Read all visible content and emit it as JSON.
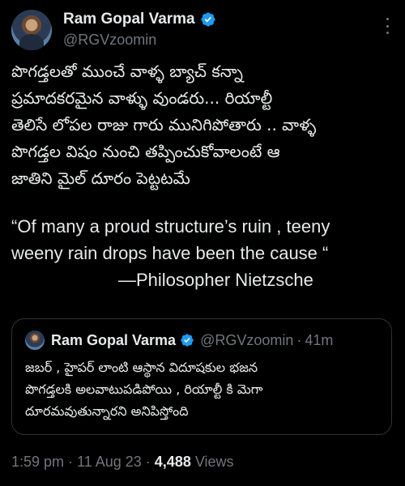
{
  "author": {
    "display_name": "Ram Gopal Varma",
    "handle": "@RGVzoomin",
    "verified_icon": "verified-badge-icon",
    "badge_color": "#1d9bf0"
  },
  "tweet": {
    "telugu_lines": [
      "పొగడ్తలతో ముంచే వాళ్ళ బ్యాచ్ కన్నా",
      "ప్రమాదకరమైన వాళ్ళు వుండరు... రియాల్టీ",
      "తెలిసే లోపల రాజు గారు మునిగిపోతారు .. వాళ్ళ",
      "పొగడ్తల విషం నుంచి తప్పించుకోవాలంటే ఆ",
      "జాతిని మైల్ దూరం పెట్టటమే"
    ],
    "quote_lines": [
      "“Of many a proud structure’s ruin , teeny",
      "weeny rain drops have been the cause “"
    ],
    "attribution": "—Philosopher Nietzsche"
  },
  "quoted_tweet": {
    "display_name": "Ram Gopal Varma",
    "handle": "@RGVzoomin",
    "separator": "·",
    "time": "41m",
    "text_lines": [
      "జబర్ , హైపర్ లాంటి ఆస్థాన విదూషకుల  భజన",
      "పొగడ్తలకి అలవాటుపడిపోయి , రియాల్టీ కి మెగా",
      "దూరమవుతున్నారని అనిపిస్తోంది"
    ]
  },
  "meta": {
    "time": "1:59 pm",
    "separator": "·",
    "date": "11 Aug 23",
    "views_count": "4,488",
    "views_label": "Views"
  },
  "colors": {
    "background": "#000000",
    "text_primary": "#e7e9ea",
    "text_secondary": "#71767b",
    "border": "#2f3336"
  }
}
